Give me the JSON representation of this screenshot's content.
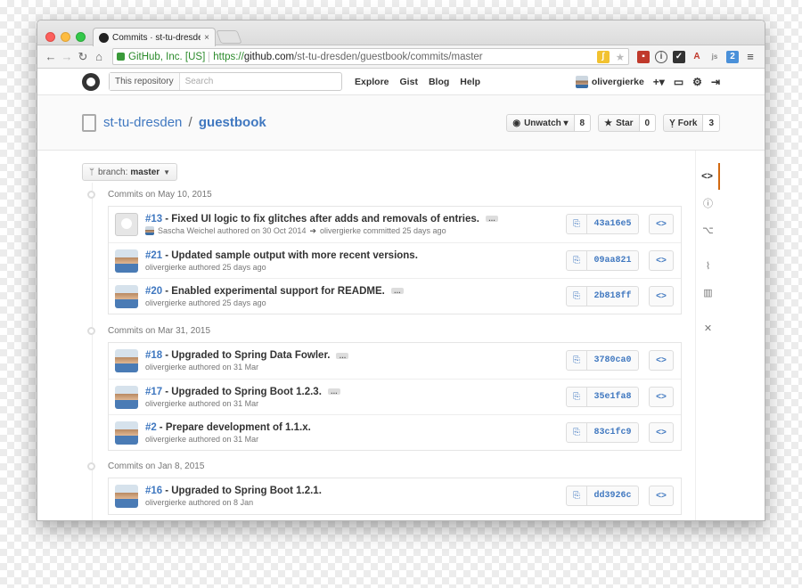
{
  "browser": {
    "tab_title": "Commits · st-tu-dresden/",
    "tab_close": "×",
    "ev_label": "GitHub, Inc. [US]",
    "url_proto": "https://",
    "url_host": "github.com",
    "url_path": "/st-tu-dresden/guestbook/commits/master"
  },
  "gh_header": {
    "search_scope": "This repository",
    "search_placeholder": "Search",
    "nav": [
      "Explore",
      "Gist",
      "Blog",
      "Help"
    ],
    "username": "olivergierke",
    "plus": "+▾"
  },
  "repo": {
    "owner": "st-tu-dresden",
    "separator": "/",
    "name": "guestbook",
    "watch_label": "Unwatch ▾",
    "watch_count": "8",
    "star_label": "Star",
    "star_count": "0",
    "fork_label": "Fork",
    "fork_count": "3"
  },
  "branch": {
    "prefix": "branch:",
    "name": "master"
  },
  "groups": [
    {
      "title": "Commits on May 10, 2015",
      "commits": [
        {
          "num": "#13",
          "msg": "- Fixed UI logic to fix glitches after adds and removals of entries.",
          "author": "Sascha Weichel authored on 30 Oct 2014",
          "committer": "olivergierke committed 25 days ago",
          "sha": "43a16e5",
          "avatar": "ghost"
        },
        {
          "num": "#21",
          "msg": "- Updated sample output with more recent versions.",
          "author": "olivergierke authored 25 days ago",
          "committer": "",
          "sha": "09aa821",
          "avatar": "photo"
        },
        {
          "num": "#20",
          "msg": "- Enabled experimental support for README.",
          "author": "olivergierke authored 25 days ago",
          "committer": "",
          "sha": "2b818ff",
          "avatar": "photo"
        }
      ]
    },
    {
      "title": "Commits on Mar 31, 2015",
      "commits": [
        {
          "num": "#18",
          "msg": "- Upgraded to Spring Data Fowler.",
          "author": "olivergierke authored on 31 Mar",
          "committer": "",
          "sha": "3780ca0",
          "avatar": "photo"
        },
        {
          "num": "#17",
          "msg": "- Upgraded to Spring Boot 1.2.3.",
          "author": "olivergierke authored on 31 Mar",
          "committer": "",
          "sha": "35e1fa8",
          "avatar": "photo"
        },
        {
          "num": "#2",
          "msg": "- Prepare development of 1.1.x.",
          "author": "olivergierke authored on 31 Mar",
          "committer": "",
          "sha": "83c1fc9",
          "avatar": "photo"
        }
      ]
    },
    {
      "title": "Commits on Jan 8, 2015",
      "commits": [
        {
          "num": "#16",
          "msg": "- Upgraded to Spring Boot 1.2.1.",
          "author": "olivergierke authored on 8 Jan",
          "committer": "",
          "sha": "dd3926c",
          "avatar": "photo"
        }
      ]
    }
  ],
  "labels": {
    "ellipsis": "…",
    "browse": "<>"
  },
  "rail": [
    {
      "icon": "code-icon",
      "glyph": "<>",
      "active": true
    },
    {
      "icon": "issues-icon",
      "glyph": "ⓘ",
      "active": false
    },
    {
      "icon": "pull-request-icon",
      "glyph": "⌥",
      "active": false
    },
    {
      "icon": "pulse-icon",
      "glyph": "⌇",
      "active": false
    },
    {
      "icon": "graphs-icon",
      "glyph": "▥",
      "active": false
    },
    {
      "icon": "settings-icon",
      "glyph": "✕",
      "active": false
    }
  ],
  "colors": {
    "link": "#4078c0",
    "accent": "#d26911"
  }
}
